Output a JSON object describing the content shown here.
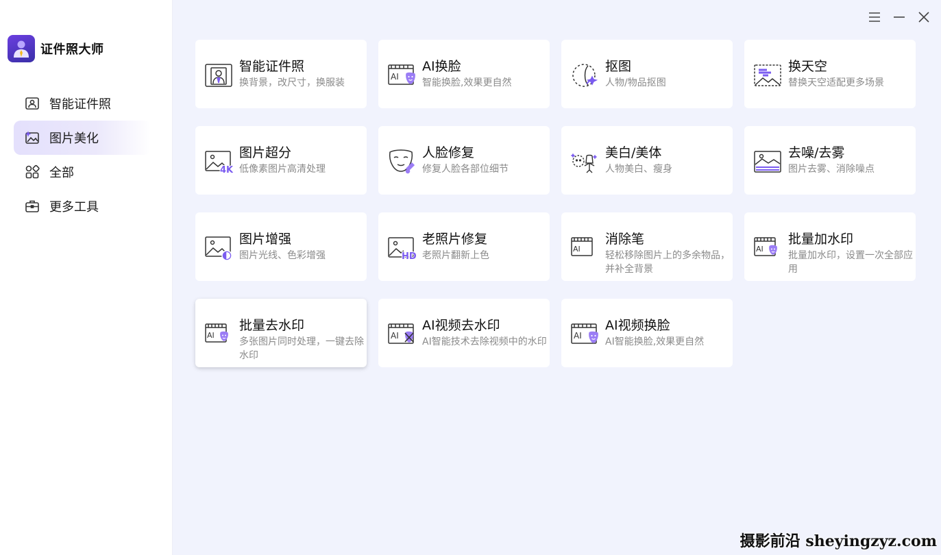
{
  "app": {
    "name": "证件照大师"
  },
  "sidebar": {
    "items": [
      {
        "label": "智能证件照",
        "icon": "id-photo-icon"
      },
      {
        "label": "图片美化",
        "icon": "image-beautify-icon"
      },
      {
        "label": "全部",
        "icon": "all-apps-icon"
      },
      {
        "label": "更多工具",
        "icon": "toolbox-icon"
      }
    ],
    "active_index": 1
  },
  "window_controls": [
    "menu-icon",
    "minimize-icon",
    "close-icon"
  ],
  "tools": [
    {
      "title": "智能证件照",
      "desc": "换背景，改尺寸，换服装",
      "icon": "id-photo-icon"
    },
    {
      "title": "AI换脸",
      "desc": "智能换脸,效果更自然",
      "icon": "ai-face-swap-icon"
    },
    {
      "title": "抠图",
      "desc": "人物/物品抠图",
      "icon": "cutout-icon"
    },
    {
      "title": "换天空",
      "desc": "替换天空适配更多场景",
      "icon": "sky-replace-icon"
    },
    {
      "title": "图片超分",
      "desc": "低像素图片高清处理",
      "icon": "super-resolution-icon"
    },
    {
      "title": "人脸修复",
      "desc": "修复人脸各部位细节",
      "icon": "face-repair-icon"
    },
    {
      "title": "美白/美体",
      "desc": "人物美白、瘦身",
      "icon": "whiten-body-icon"
    },
    {
      "title": "去噪/去雾",
      "desc": "图片去雾、消除噪点",
      "icon": "denoise-icon"
    },
    {
      "title": "图片增强",
      "desc": "图片光线、色彩增强",
      "icon": "enhance-icon"
    },
    {
      "title": "老照片修复",
      "desc": "老照片翻新上色",
      "icon": "old-photo-icon"
    },
    {
      "title": "消除笔",
      "desc": "轻松移除图片上的多余物品，并补全背景",
      "icon": "eraser-icon"
    },
    {
      "title": "批量加水印",
      "desc": "批量加水印，设置一次全部应用",
      "icon": "batch-watermark-icon"
    },
    {
      "title": "批量去水印",
      "desc": "多张图片同时处理，一键去除水印",
      "icon": "batch-remove-watermark-icon"
    },
    {
      "title": "AI视频去水印",
      "desc": "AI智能技术去除视频中的水印",
      "icon": "video-remove-watermark-icon"
    },
    {
      "title": "AI视频换脸",
      "desc": "AI智能换脸,效果更自然",
      "icon": "video-face-swap-icon"
    }
  ],
  "watermark": "摄影前沿 sheyingzyz.com",
  "colors": {
    "accent": "#7b5cf0",
    "accent_light": "#a58cf5",
    "background": "#f1f3fd",
    "icon_stroke": "#333333"
  }
}
